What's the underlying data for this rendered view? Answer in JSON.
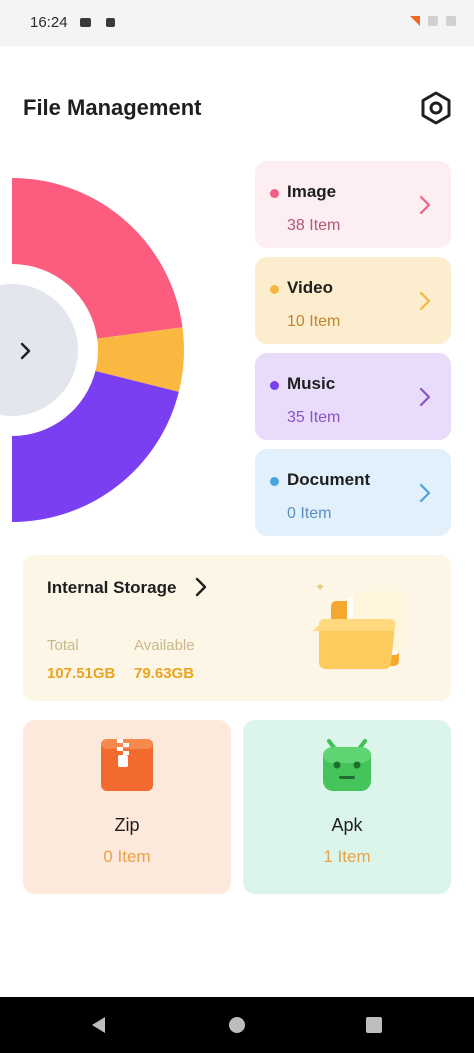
{
  "status_bar": {
    "time": "16:24"
  },
  "header": {
    "title": "File Management",
    "settings_icon": "settings-icon"
  },
  "chart_data": {
    "type": "pie",
    "categories": [
      "Image",
      "Video",
      "Music",
      "Document"
    ],
    "values": [
      38,
      10,
      35,
      0
    ],
    "colors": [
      "#fc5c7d",
      "#fbb840",
      "#7b3ff2",
      "#4aa3df"
    ]
  },
  "categories": [
    {
      "label": "Image",
      "count": "38 Item",
      "dot_color": "#f25f86",
      "bg": "#fdeef1",
      "count_color": "#b25874",
      "chevron_color": "#f25f86"
    },
    {
      "label": "Video",
      "count": "10 Item",
      "dot_color": "#f5b73e",
      "bg": "#fdedcf",
      "count_color": "#c0862f",
      "chevron_color": "#f5b73e"
    },
    {
      "label": "Music",
      "count": "35 Item",
      "dot_color": "#7b3ff2",
      "bg": "#e9dcfa",
      "count_color": "#8a54c6",
      "chevron_color": "#8a54c6"
    },
    {
      "label": "Document",
      "count": "0 Item",
      "dot_color": "#4aa3df",
      "bg": "#e2f0fc",
      "count_color": "#5b8fc1",
      "chevron_color": "#4aa3df"
    }
  ],
  "storage": {
    "title": "Internal Storage",
    "total_label": "Total",
    "total_value": "107.51GB",
    "available_label": "Available",
    "available_value": "79.63GB"
  },
  "tiles": [
    {
      "name": "Zip",
      "count": "0 Item",
      "icon": "zip-icon",
      "bg": "#fde8dc"
    },
    {
      "name": "Apk",
      "count": "1 Item",
      "icon": "android-icon",
      "bg": "#dcf5ea"
    }
  ],
  "nav": {
    "back_icon": "back-icon",
    "home_icon": "home-icon",
    "recents_icon": "recents-icon"
  }
}
